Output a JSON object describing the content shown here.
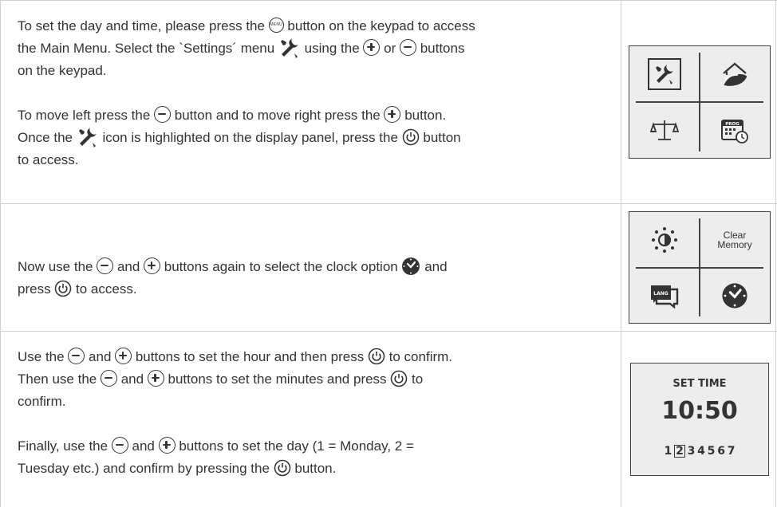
{
  "rows": [
    {
      "p1": [
        "To set the day and time, please press the ",
        " button on the keypad to access",
        "the Main Menu. Select the `Settings´ menu ",
        " using the ",
        " or ",
        " buttons",
        "on the keypad."
      ],
      "p2": [
        "To move left press the ",
        " button and to move right press the ",
        " button.",
        "Once the ",
        " icon is highlighted on the display panel, press the ",
        " button",
        "to access."
      ]
    },
    {
      "p1": [
        "Now use the ",
        " and ",
        " buttons again to select the clock option ",
        " and",
        "press ",
        " to access."
      ]
    },
    {
      "p1": [
        "Use the ",
        " and ",
        " buttons to set the hour and then press ",
        " to confirm.",
        "Then use the ",
        " and ",
        " buttons to set the minutes and press ",
        " to",
        "confirm."
      ],
      "p2": [
        "Finally, use the ",
        " and ",
        " buttons to set the day (1 = Monday, 2 =",
        "Tuesday etc.) and confirm by pressing the ",
        " button."
      ]
    }
  ],
  "keys": {
    "menu": "MENU"
  },
  "panels": {
    "main_menu": {
      "prog_label": "PROG"
    },
    "settings_menu": {
      "clear_memory": [
        "Clear",
        "Memory"
      ],
      "lang_label": "LANG"
    },
    "set_time": {
      "label": "SET TIME",
      "time": "10:50",
      "days": [
        "1",
        "2",
        "3",
        "4",
        "5",
        "6",
        "7"
      ],
      "selected_day": "2"
    }
  },
  "colors": {
    "text": "#333333",
    "panel_bg": "#ededed",
    "grid": "#cfcfcf"
  },
  "icons": [
    "menu-key-icon",
    "plus-key-icon",
    "minus-key-icon",
    "power-key-icon",
    "settings-tools-icon",
    "clock-icon",
    "eco-leaf-icon",
    "balance-icon",
    "program-calendar-icon",
    "brightness-icon",
    "language-icon"
  ]
}
